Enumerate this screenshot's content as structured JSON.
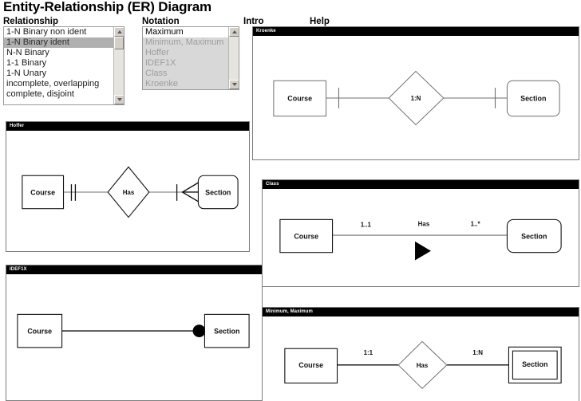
{
  "header": {
    "title": "Entity-Relationship (ER) Diagram",
    "relationship_label": "Relationship",
    "notation_label": "Notation",
    "intro_link": "Intro",
    "help_link": "Help"
  },
  "relationship_list": {
    "selected": "1-N Binary ident",
    "items": [
      "1-N Binary non ident",
      "1-N Binary ident",
      "N-N Binary",
      "1-1 Binary",
      "1-N Unary",
      "incomplete, overlapping",
      "complete, disjoint"
    ]
  },
  "notation_list": {
    "selected": "Maximum",
    "disabled": true,
    "items": [
      "Maximum",
      "Minimum, Maximum",
      "Hoffer",
      "IDEF1X",
      "Class",
      "Kroenke"
    ]
  },
  "panels": {
    "kroenke": {
      "title": "Kroenke",
      "entity_left": "Course",
      "entity_right": "Section",
      "relationship": "1:N"
    },
    "hoffer": {
      "title": "Hoffer",
      "entity_left": "Course",
      "entity_right": "Section",
      "relationship": "Has"
    },
    "idef1x": {
      "title": "IDEF1X",
      "entity_left": "Course",
      "entity_right": "Section"
    },
    "class": {
      "title": "Class",
      "entity_left": "Course",
      "entity_right": "Section",
      "relationship": "Has",
      "cardinality_left": "1..1",
      "cardinality_right": "1..*"
    },
    "minmax": {
      "title": "Minimum, Maximum",
      "entity_left": "Course",
      "entity_right": "Section",
      "relationship": "Has",
      "cardinality_left": "1:1",
      "cardinality_right": "1:N"
    }
  },
  "colors": {
    "titlebar_bg": "#000000",
    "titlebar_text": "#ffffff",
    "selection_bg": "#b0b0b0",
    "disabled_text": "#9d9d9d",
    "panel_border": "#7d7d7d"
  }
}
